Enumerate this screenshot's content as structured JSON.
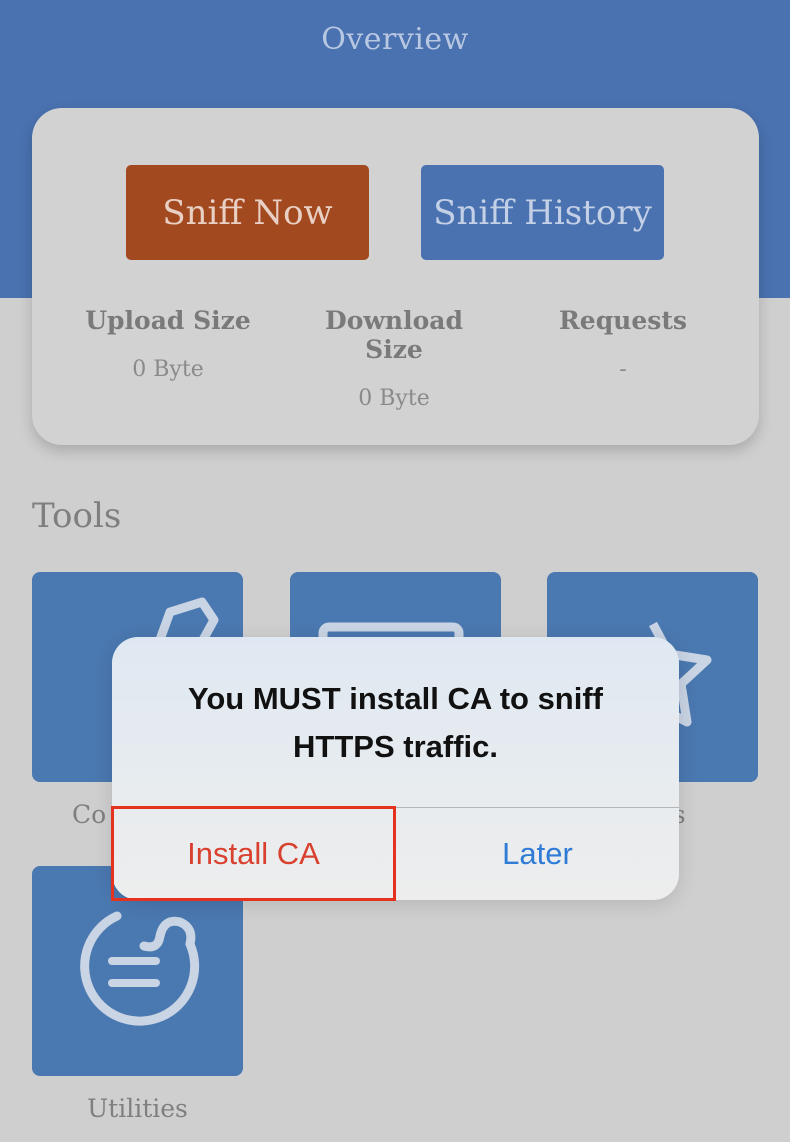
{
  "header": {
    "title": "Overview"
  },
  "overview_card": {
    "sniff_now_label": "Sniff Now",
    "sniff_history_label": "Sniff History",
    "stats": [
      {
        "label": "Upload Size",
        "value": "0 Byte"
      },
      {
        "label": "Download Size",
        "value": "0 Byte"
      },
      {
        "label": "Requests",
        "value": "-"
      }
    ]
  },
  "tools": {
    "title": "Tools",
    "items": [
      {
        "label": "Co",
        "icon": "pencil-icon"
      },
      {
        "label": "",
        "icon": "monitor-icon"
      },
      {
        "label": "es",
        "icon": "star-icon"
      },
      {
        "label": "Utilities",
        "icon": "chat-bubble-icon"
      }
    ]
  },
  "alert": {
    "message": "You MUST install CA to sniff HTTPS traffic.",
    "install_label": "Install CA",
    "later_label": "Later"
  },
  "colors": {
    "header_blue": "#4a72b0",
    "sniff_now_orange": "#a3491f",
    "install_red": "#d9412f",
    "later_blue": "#2f7bd6",
    "highlight_red": "#e4321f"
  }
}
